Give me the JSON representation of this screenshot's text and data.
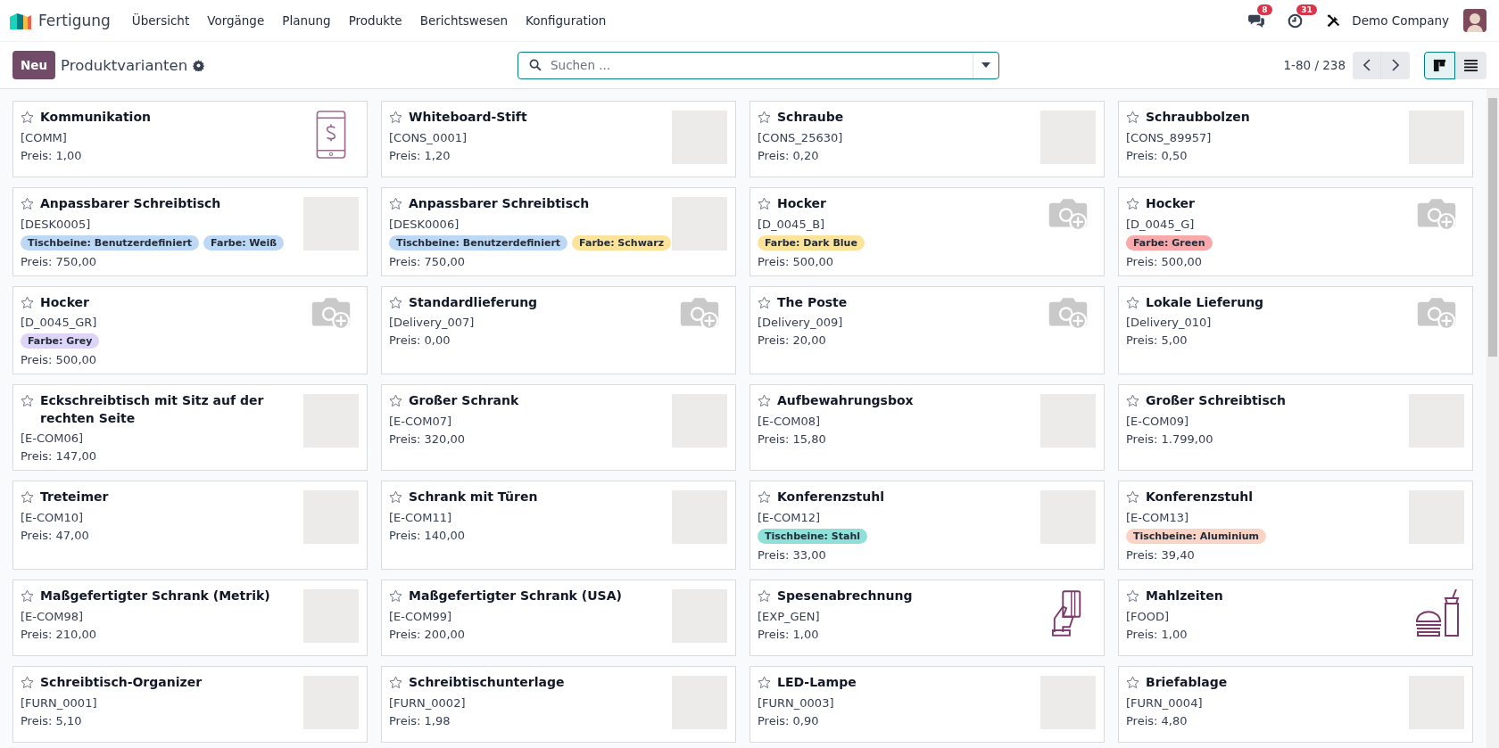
{
  "app": {
    "name": "Fertigung",
    "menu": [
      "Übersicht",
      "Vorgänge",
      "Planung",
      "Produkte",
      "Berichtswesen",
      "Konfiguration"
    ]
  },
  "systray": {
    "messages_count": "8",
    "activities_count": "31",
    "company": "Demo Company"
  },
  "control_panel": {
    "new_button": "Neu",
    "title": "Produktvarianten",
    "search": {
      "placeholder": "Suchen ..."
    },
    "pager": "1-80 / 238",
    "views": [
      {
        "kind": "kanban",
        "selected": true
      },
      {
        "kind": "list",
        "selected": false
      }
    ]
  },
  "cards": [
    {
      "name": "Kommunikation",
      "code": "[COMM]",
      "price": "Preis: 1,00",
      "favorite": false,
      "kind": "phone"
    },
    {
      "name": "Whiteboard-Stift",
      "code": "[CONS_0001]",
      "price": "Preis: 1,20",
      "favorite": false,
      "kind": "photo"
    },
    {
      "name": "Schraube",
      "code": "[CONS_25630]",
      "price": "Preis: 0,20",
      "favorite": false,
      "kind": "photo"
    },
    {
      "name": "Schraubbolzen",
      "code": "[CONS_89957]",
      "price": "Preis: 0,50",
      "favorite": false,
      "kind": "photo"
    },
    {
      "name": "Anpassbarer Schreibtisch",
      "code": "[DESK0005]",
      "price": "Preis: 750,00",
      "favorite": false,
      "kind": "photo",
      "tags": [
        {
          "label": "Tischbeine: Benutzerdefiniert",
          "color": "#bcd8f5"
        },
        {
          "label": "Farbe: Weiß",
          "color": "#bcd8f5"
        }
      ]
    },
    {
      "name": "Anpassbarer Schreibtisch",
      "code": "[DESK0006]",
      "price": "Preis: 750,00",
      "favorite": false,
      "kind": "photo",
      "tags": [
        {
          "label": "Tischbeine: Benutzerdefiniert",
          "color": "#bcd8f5"
        },
        {
          "label": "Farbe: Schwarz",
          "color": "#fbe49a"
        }
      ]
    },
    {
      "name": "Hocker",
      "code": "[D_0045_B]",
      "price": "Preis: 500,00",
      "favorite": false,
      "kind": "empty",
      "tags": [
        {
          "label": "Farbe: Dark Blue",
          "color": "#fbe49a"
        }
      ]
    },
    {
      "name": "Hocker",
      "code": "[D_0045_G]",
      "price": "Preis: 500,00",
      "favorite": false,
      "kind": "empty",
      "tags": [
        {
          "label": "Farbe: Green",
          "color": "#f9a9a9"
        }
      ]
    },
    {
      "name": "Hocker",
      "code": "[D_0045_GR]",
      "price": "Preis: 500,00",
      "favorite": false,
      "kind": "empty",
      "tags": [
        {
          "label": "Farbe: Grey",
          "color": "#ddd4f8"
        }
      ]
    },
    {
      "name": "Standardlieferung",
      "code": "[Delivery_007]",
      "price": "Preis: 0,00",
      "favorite": false,
      "kind": "empty"
    },
    {
      "name": "The Poste",
      "code": "[Delivery_009]",
      "price": "Preis: 20,00",
      "favorite": false,
      "kind": "empty"
    },
    {
      "name": "Lokale Lieferung",
      "code": "[Delivery_010]",
      "price": "Preis: 5,00",
      "favorite": false,
      "kind": "empty"
    },
    {
      "name": "Eckschreibtisch mit Sitz auf der rechten Seite",
      "code": "[E-COM06]",
      "price": "Preis: 147,00",
      "favorite": false,
      "kind": "photo"
    },
    {
      "name": "Großer Schrank",
      "code": "[E-COM07]",
      "price": "Preis: 320,00",
      "favorite": false,
      "kind": "photo"
    },
    {
      "name": "Aufbewahrungsbox",
      "code": "[E-COM08]",
      "price": "Preis: 15,80",
      "favorite": false,
      "kind": "photo"
    },
    {
      "name": "Großer Schreibtisch",
      "code": "[E-COM09]",
      "price": "Preis: 1.799,00",
      "favorite": false,
      "kind": "photo"
    },
    {
      "name": "Treteimer",
      "code": "[E-COM10]",
      "price": "Preis: 47,00",
      "favorite": false,
      "kind": "photo"
    },
    {
      "name": "Schrank mit Türen",
      "code": "[E-COM11]",
      "price": "Preis: 140,00",
      "favorite": false,
      "kind": "photo"
    },
    {
      "name": "Konferenzstuhl",
      "code": "[E-COM12]",
      "price": "Preis: 33,00",
      "favorite": false,
      "kind": "photo",
      "tags": [
        {
          "label": "Tischbeine: Stahl",
          "color": "#8ee0d8"
        }
      ]
    },
    {
      "name": "Konferenzstuhl",
      "code": "[E-COM13]",
      "price": "Preis: 39,40",
      "favorite": false,
      "kind": "photo",
      "tags": [
        {
          "label": "Tischbeine: Aluminium",
          "color": "#f9d4c4"
        }
      ]
    },
    {
      "name": "Maßgefertigter Schrank (Metrik)",
      "code": "[E-COM98]",
      "price": "Preis: 210,00",
      "favorite": false,
      "kind": "photo"
    },
    {
      "name": "Maßgefertigter Schrank (USA)",
      "code": "[E-COM99]",
      "price": "Preis: 200,00",
      "favorite": false,
      "kind": "photo"
    },
    {
      "name": "Spesenabrechnung",
      "code": "[EXP_GEN]",
      "price": "Preis: 1,00",
      "favorite": false,
      "kind": "card"
    },
    {
      "name": "Mahlzeiten",
      "code": "[FOOD]",
      "price": "Preis: 1,00",
      "favorite": false,
      "kind": "meal"
    },
    {
      "name": "Schreibtisch-Organizer",
      "code": "[FURN_0001]",
      "price": "Preis: 5,10",
      "favorite": false,
      "kind": "photo"
    },
    {
      "name": "Schreibtischunterlage",
      "code": "[FURN_0002]",
      "price": "Preis: 1,98",
      "favorite": false,
      "kind": "photo"
    },
    {
      "name": "LED-Lampe",
      "code": "[FURN_0003]",
      "price": "Preis: 0,90",
      "favorite": false,
      "kind": "photo"
    },
    {
      "name": "Briefablage",
      "code": "[FURN_0004]",
      "price": "Preis: 4,80",
      "favorite": false,
      "kind": "photo"
    }
  ]
}
